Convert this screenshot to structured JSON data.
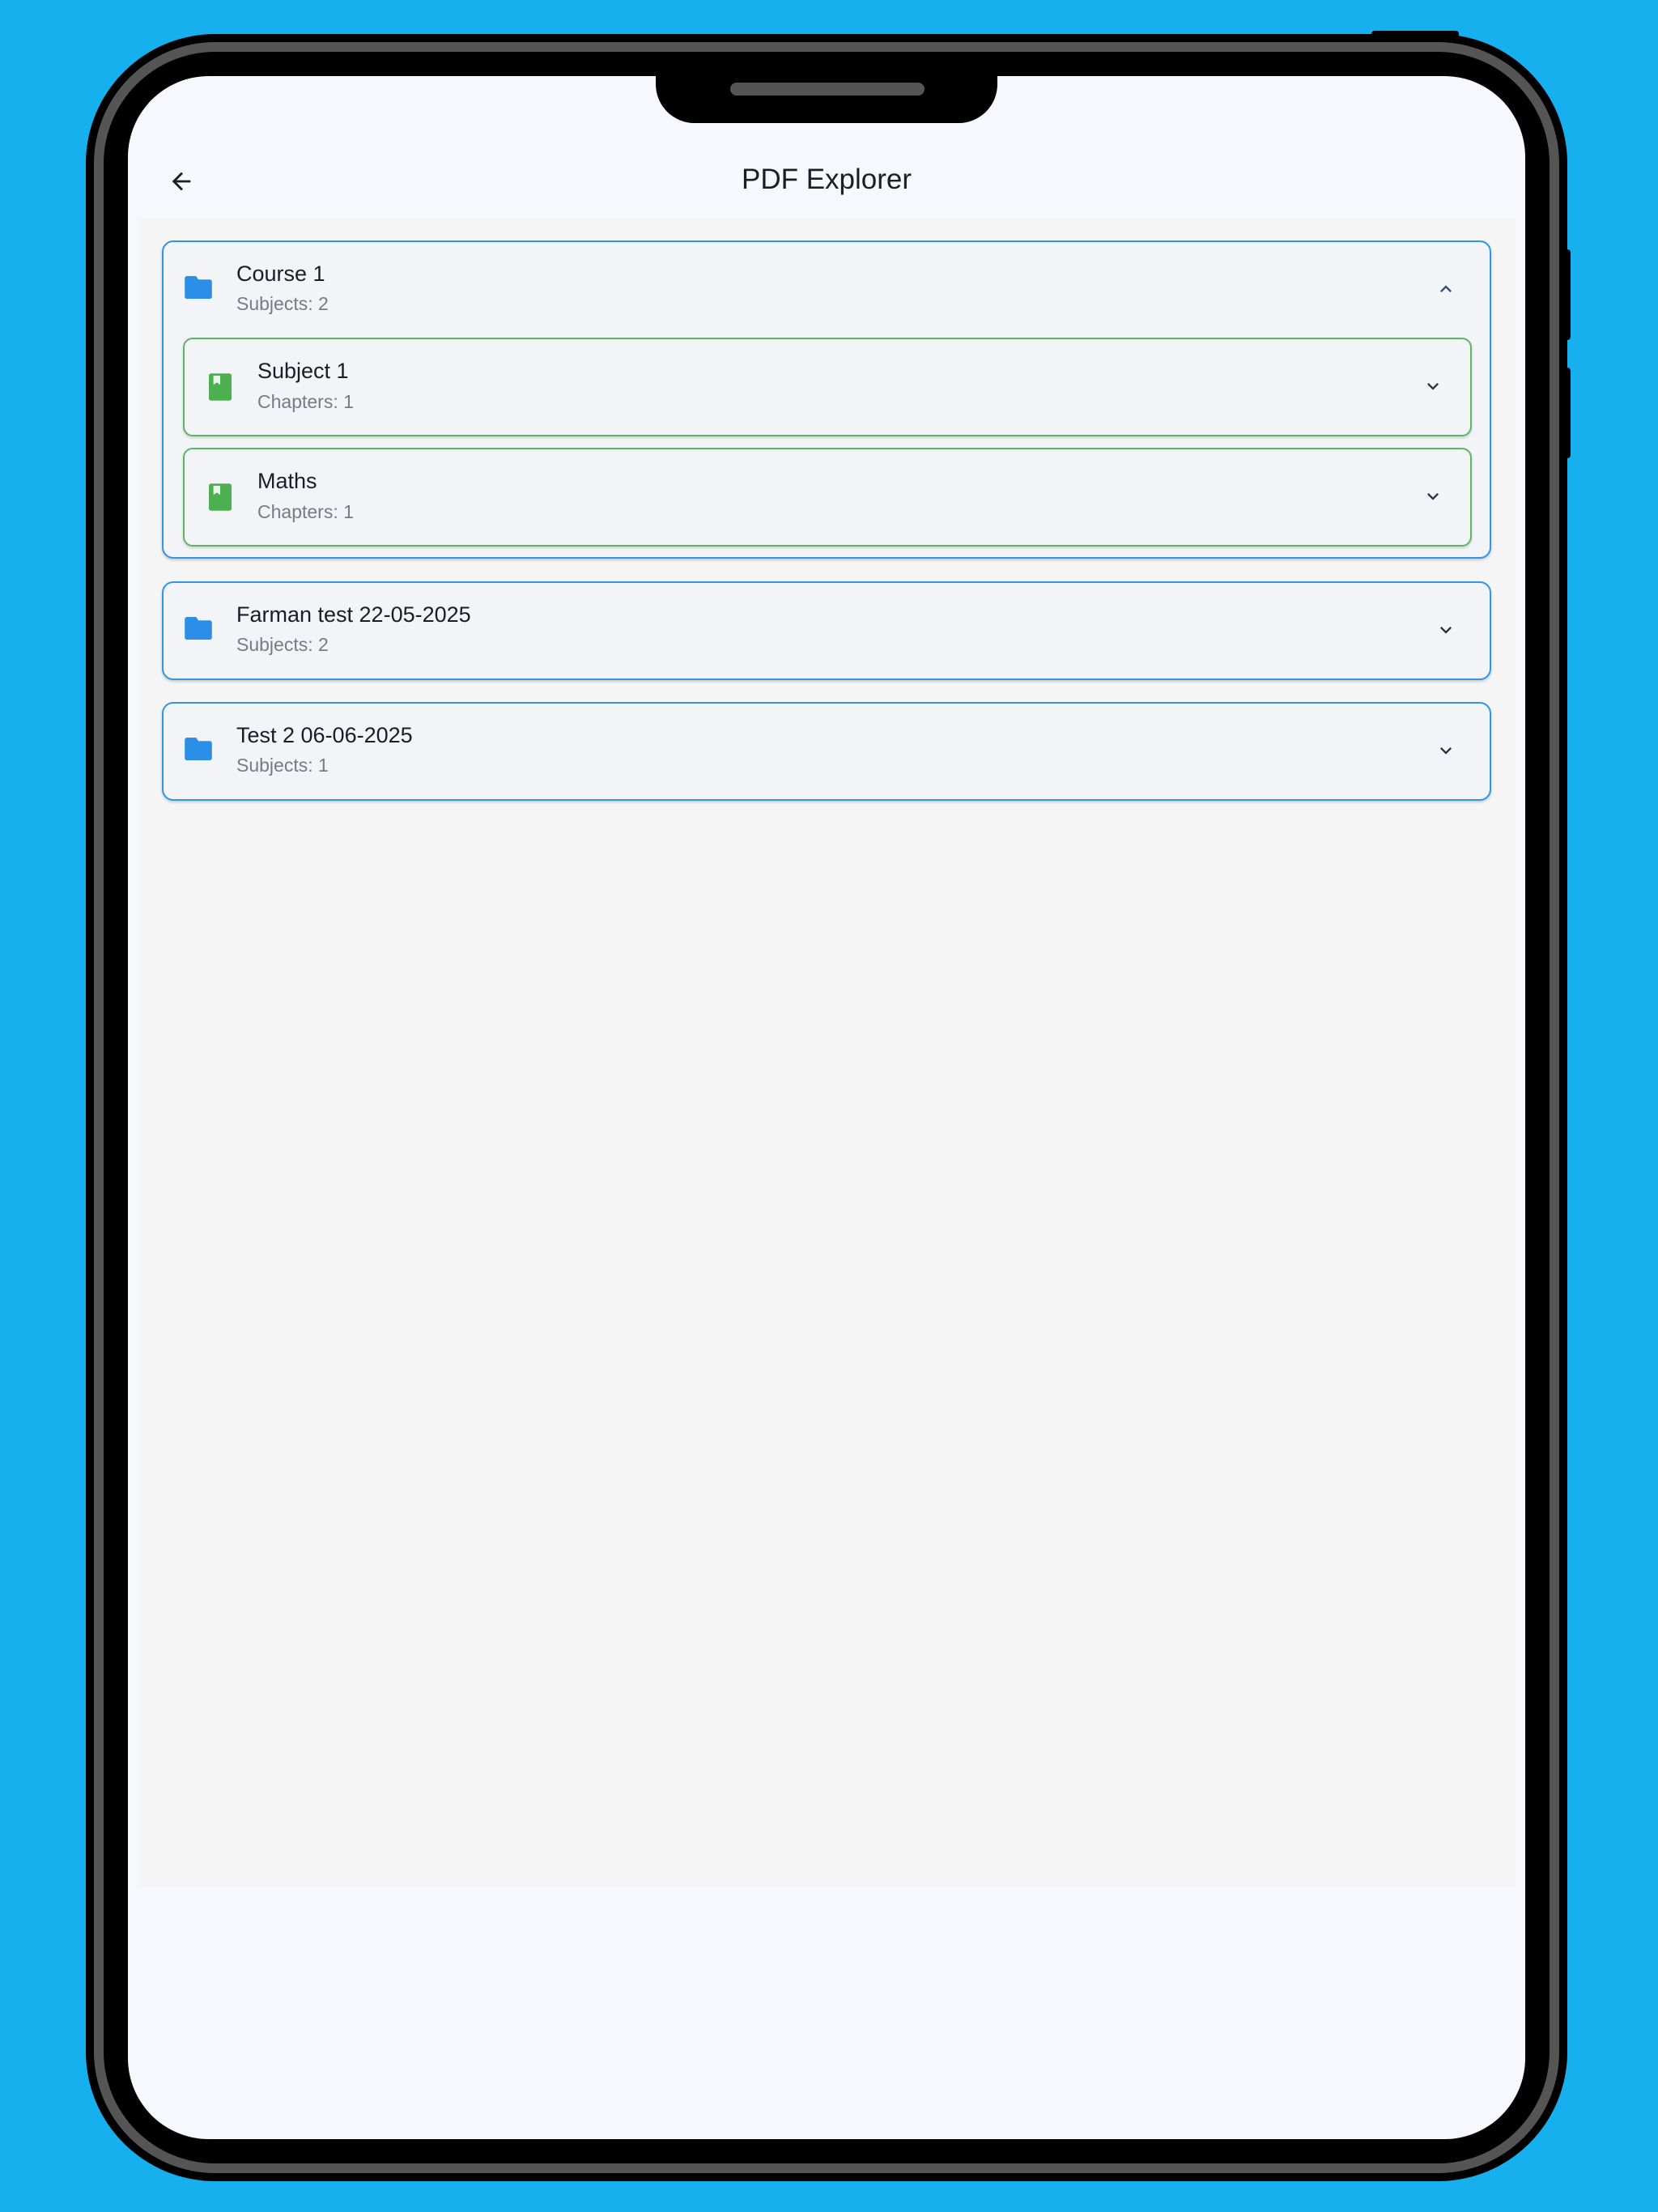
{
  "app": {
    "title": "PDF Explorer"
  },
  "colors": {
    "background": "#17b0ef",
    "course_border": "#2f96e8",
    "subject_border": "#5bb565",
    "folder_icon": "#2b8fe8",
    "book_icon": "#4caf50"
  },
  "icons": {
    "back": "arrow-back-icon",
    "folder": "folder-icon",
    "book": "book-icon",
    "expand": "chevron-down-icon",
    "collapse": "chevron-up-icon"
  },
  "courses": [
    {
      "title": "Course 1",
      "subtitle": "Subjects: 2",
      "expanded": true,
      "subjects": [
        {
          "title": "Subject 1",
          "subtitle": "Chapters: 1"
        },
        {
          "title": "Maths",
          "subtitle": "Chapters: 1"
        }
      ]
    },
    {
      "title": "Farman test 22-05-2025",
      "subtitle": "Subjects: 2",
      "expanded": false
    },
    {
      "title": "Test 2 06-06-2025",
      "subtitle": "Subjects: 1",
      "expanded": false
    }
  ]
}
